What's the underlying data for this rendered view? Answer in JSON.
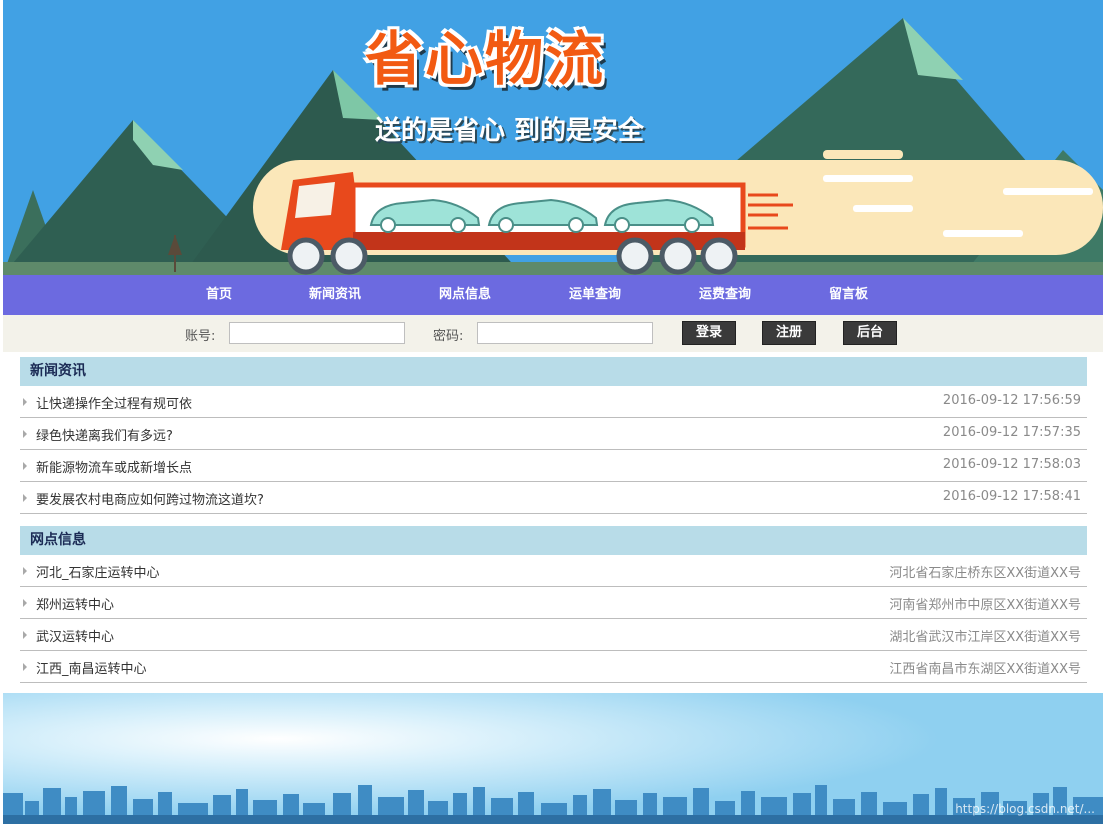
{
  "banner": {
    "brand_name": "省心物流",
    "slogan": "送的是省心 到的是安全"
  },
  "nav": {
    "items": [
      "首页",
      "新闻资讯",
      "网点信息",
      "运单查询",
      "运费查询",
      "留言板"
    ]
  },
  "login": {
    "account_label": "账号:",
    "password_label": "密码:",
    "account_value": "",
    "password_value": "",
    "login_button": "登录",
    "register_button": "注册",
    "admin_button": "后台"
  },
  "news": {
    "heading": "新闻资讯",
    "items": [
      {
        "title": "让快递操作全过程有规可依",
        "date": "2016-09-12 17:56:59"
      },
      {
        "title": "绿色快递离我们有多远?",
        "date": "2016-09-12 17:57:35"
      },
      {
        "title": "新能源物流车或成新增长点",
        "date": "2016-09-12 17:58:03"
      },
      {
        "title": "要发展农村电商应如何跨过物流这道坎?",
        "date": "2016-09-12 17:58:41"
      }
    ]
  },
  "branches": {
    "heading": "网点信息",
    "items": [
      {
        "name": "河北_石家庄运转中心",
        "address": "河北省石家庄桥东区XX街道XX号"
      },
      {
        "name": "郑州运转中心",
        "address": "河南省郑州市中原区XX街道XX号"
      },
      {
        "name": "武汉运转中心",
        "address": "湖北省武汉市江岸区XX街道XX号"
      },
      {
        "name": "江西_南昌运转中心",
        "address": "江西省南昌市东湖区XX街道XX号"
      }
    ]
  },
  "footer": {
    "watermark": "https://blog.csdn.net/..."
  },
  "colors": {
    "nav_bg": "#6c6ae0",
    "section_header_bg": "#b8dce8",
    "sky": "#41a1e4",
    "truck_red": "#e8491c",
    "button_dark": "#3a3a3a"
  }
}
